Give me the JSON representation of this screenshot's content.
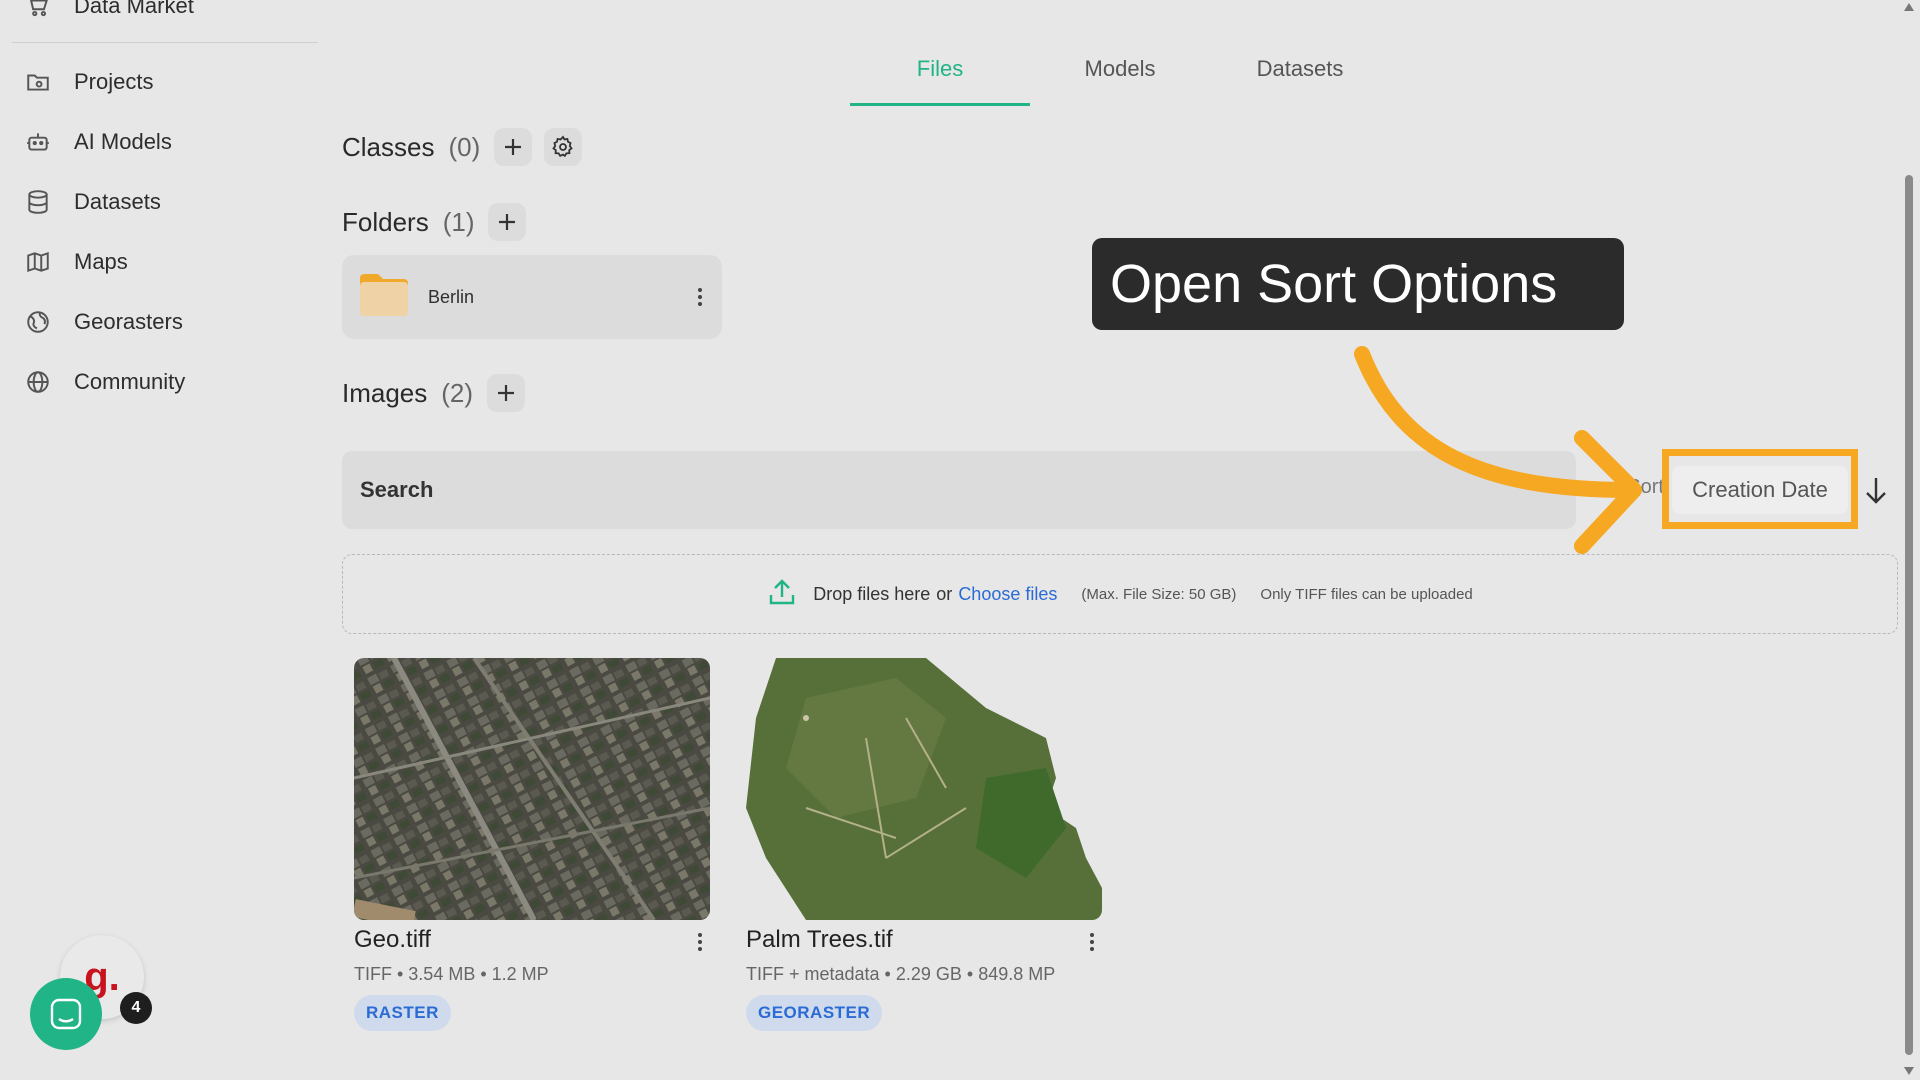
{
  "sidebar": {
    "items": [
      {
        "label": "Data Market",
        "icon": "cart-icon"
      },
      {
        "label": "Projects",
        "icon": "folder-icon"
      },
      {
        "label": "AI Models",
        "icon": "robot-icon"
      },
      {
        "label": "Datasets",
        "icon": "database-icon"
      },
      {
        "label": "Maps",
        "icon": "map-icon"
      },
      {
        "label": "Georasters",
        "icon": "globe-grid-icon"
      },
      {
        "label": "Community",
        "icon": "globe-icon"
      }
    ]
  },
  "tabs": [
    {
      "label": "Files",
      "active": true
    },
    {
      "label": "Models",
      "active": false
    },
    {
      "label": "Datasets",
      "active": false
    }
  ],
  "classes": {
    "title": "Classes",
    "count": "(0)"
  },
  "folders": {
    "title": "Folders",
    "count": "(1)",
    "items": [
      {
        "name": "Berlin"
      }
    ]
  },
  "images": {
    "title": "Images",
    "count": "(2)"
  },
  "search": {
    "placeholder": "Search"
  },
  "sort": {
    "label": "Sort",
    "value": "Creation Date",
    "direction": "descending"
  },
  "upload": {
    "drop_text": "Drop files here",
    "or_text": "or",
    "choose_text": "Choose files",
    "max_size": "(Max. File Size: 50 GB)",
    "only_text": "Only TIFF files can be uploaded"
  },
  "files": [
    {
      "name": "Geo.tiff",
      "meta": "TIFF • 3.54 MB • 1.2 MP",
      "badge": "RASTER"
    },
    {
      "name": "Palm Trees.tif",
      "meta": "TIFF + metadata • 2.29 GB • 849.8 MP",
      "badge": "GEORASTER"
    }
  ],
  "tooltip": {
    "text": "Open Sort Options"
  },
  "chat": {
    "notification_count": "4",
    "avatar_letter": "g."
  },
  "colors": {
    "accent": "#20b486",
    "highlight": "#f7a823",
    "link": "#2a6bd6",
    "tooltip_bg": "#2b2b2b"
  }
}
